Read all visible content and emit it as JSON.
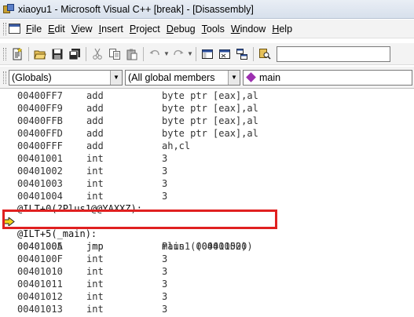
{
  "window": {
    "title": "xiaoyu1 - Microsoft Visual C++ [break] - [Disassembly]"
  },
  "menu": [
    {
      "accel": "F",
      "rest": "ile"
    },
    {
      "accel": "E",
      "rest": "dit"
    },
    {
      "accel": "V",
      "rest": "iew"
    },
    {
      "accel": "I",
      "rest": "nsert"
    },
    {
      "accel": "P",
      "rest": "roject"
    },
    {
      "accel": "D",
      "rest": "ebug"
    },
    {
      "accel": "T",
      "rest": "ools"
    },
    {
      "accel": "W",
      "rest": "indow"
    },
    {
      "accel": "H",
      "rest": "elp"
    }
  ],
  "toolbar": {
    "icons": [
      "new-text-file-icon",
      "open-folder-icon",
      "save-icon",
      "save-all-icon",
      "cut-icon",
      "copy-icon",
      "paste-icon",
      "undo-icon",
      "redo-icon",
      "workspace-icon",
      "output-icon",
      "window-list-icon",
      "find-in-files-icon"
    ],
    "search_value": ""
  },
  "wizard": {
    "scope": "(Globals)",
    "filter": "(All global members",
    "member": "main"
  },
  "disassembly": [
    {
      "addr": "00400FF7",
      "op": "add",
      "arg": "byte ptr [eax],al"
    },
    {
      "addr": "00400FF9",
      "op": "add",
      "arg": "byte ptr [eax],al"
    },
    {
      "addr": "00400FFB",
      "op": "add",
      "arg": "byte ptr [eax],al"
    },
    {
      "addr": "00400FFD",
      "op": "add",
      "arg": "byte ptr [eax],al"
    },
    {
      "addr": "00400FFF",
      "op": "add",
      "arg": "ah,cl"
    },
    {
      "addr": "00401001",
      "op": "int",
      "arg": "3"
    },
    {
      "addr": "00401002",
      "op": "int",
      "arg": "3"
    },
    {
      "addr": "00401003",
      "op": "int",
      "arg": "3"
    },
    {
      "addr": "00401004",
      "op": "int",
      "arg": "3"
    },
    {
      "label": "@ILT+0(?Plus1@@YAXXZ):"
    },
    {
      "addr": "00401005",
      "op": "jmp",
      "arg": "Plus1 (00401020)",
      "current": true
    },
    {
      "label": "@ILT+5(_main):"
    },
    {
      "addr": "0040100A",
      "op": "jmp",
      "arg": "main (00401050)"
    },
    {
      "addr": "0040100F",
      "op": "int",
      "arg": "3"
    },
    {
      "addr": "00401010",
      "op": "int",
      "arg": "3"
    },
    {
      "addr": "00401011",
      "op": "int",
      "arg": "3"
    },
    {
      "addr": "00401012",
      "op": "int",
      "arg": "3"
    },
    {
      "addr": "00401013",
      "op": "int",
      "arg": "3"
    }
  ],
  "colors": {
    "highlight": "#e02020",
    "exec_arrow": "#f2d21a",
    "member_icon": "#9c2fb0"
  }
}
